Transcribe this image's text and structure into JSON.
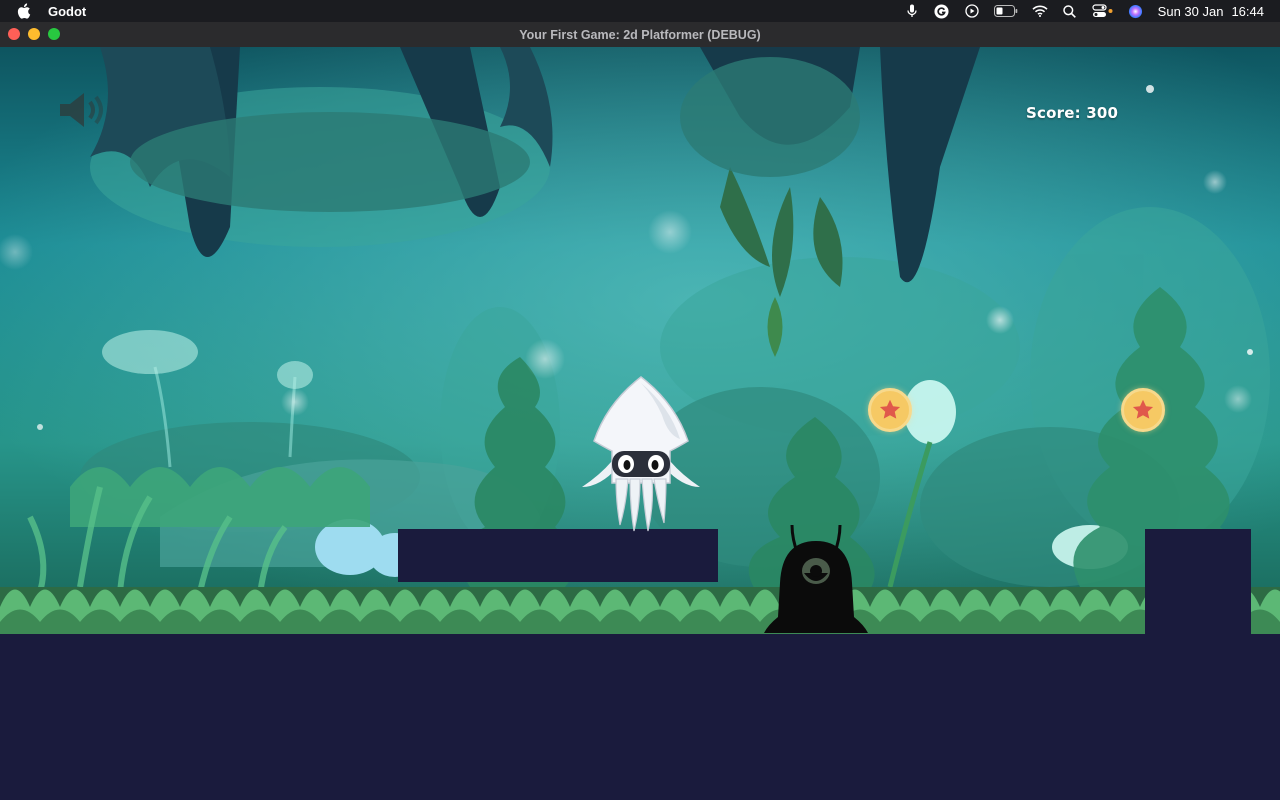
{
  "menubar": {
    "app_name": "Godot",
    "date": "Sun 30 Jan",
    "time": "16:44",
    "icons": [
      "apple-icon",
      "microphone-icon",
      "grammarly-icon",
      "play-circle-icon",
      "battery-icon",
      "wifi-icon",
      "search-icon",
      "control-center-icon",
      "siri-icon"
    ]
  },
  "window": {
    "title": "Your First Game: 2d Platformer (DEBUG)"
  },
  "game": {
    "score_label": "Score: 300",
    "sound_icon": "speaker-mute-icon",
    "player": "squid-player",
    "enemy": "black-alien-enemy",
    "coins": [
      "star-coin",
      "star-coin"
    ],
    "colors": {
      "ground": "#1a1b3d",
      "coin": "#f6c964",
      "star": "#e0584b",
      "sky_top": "#1f8a8e",
      "foliage": "#2e8a68"
    }
  }
}
